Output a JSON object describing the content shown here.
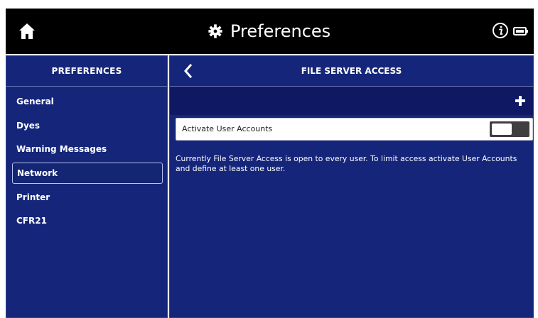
{
  "topbar": {
    "title": "Preferences",
    "home_icon": "home-icon",
    "gear_icon": "gear-icon",
    "info_icon": "info-icon",
    "battery_icon": "battery-icon"
  },
  "sidebar": {
    "header": "PREFERENCES",
    "items": [
      {
        "label": "General"
      },
      {
        "label": "Dyes"
      },
      {
        "label": "Warning Messages"
      },
      {
        "label": "Network"
      },
      {
        "label": "Printer"
      },
      {
        "label": "CFR21"
      }
    ],
    "selected": "Network"
  },
  "main": {
    "header": "FILE SERVER ACCESS",
    "back_icon": "back-icon",
    "add_icon": "plus-icon",
    "setting_label": "Activate User Accounts",
    "toggle_state": "off",
    "description": "Currently File Server Access is open to every user. To limit access activate User Accounts and define at least one user."
  },
  "colors": {
    "panel": "#15267a",
    "strip": "#0f1963",
    "topbar": "#000000"
  }
}
